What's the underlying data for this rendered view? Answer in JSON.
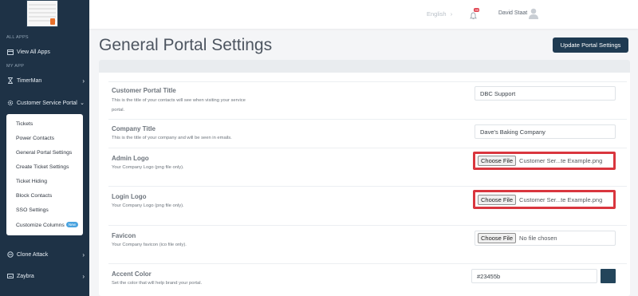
{
  "sidebar": {
    "all_apps_heading": "ALL APPS",
    "view_all_apps": "View All Apps",
    "my_app_heading": "MY APP",
    "timerman": "TimerMan",
    "customer_service_portal": "Customer Service Portal",
    "submenu": [
      {
        "label": "Tickets"
      },
      {
        "label": "Power Contacts"
      },
      {
        "label": "General Portal Settings"
      },
      {
        "label": "Create Ticket Settings"
      },
      {
        "label": "Ticket Hiding"
      },
      {
        "label": "Block Contacts"
      },
      {
        "label": "SSO Settings"
      },
      {
        "label": "Customize Columns",
        "badge": "New"
      }
    ],
    "clone_attack": "Clone Attack",
    "zaybra": "Zaybra"
  },
  "topbar": {
    "language": "English",
    "notification_count": "99",
    "user_name": "David Staat"
  },
  "page": {
    "title": "General Portal Settings",
    "update_button": "Update Portal Settings"
  },
  "settings": {
    "customer_portal_title": {
      "title": "Customer Portal Title",
      "description": "This is the title of your contacts will see when visiting your service portal.",
      "value": "DBC Support"
    },
    "company_title": {
      "title": "Company Title",
      "description": "This is the title of your company and will be seen in emails.",
      "value": "Dave's Baking Company"
    },
    "admin_logo": {
      "title": "Admin Logo",
      "description": "Your Company Logo (png file only).",
      "button": "Choose File",
      "file": "Customer Ser...te Example.png"
    },
    "login_logo": {
      "title": "Login Logo",
      "description": "Your Company Logo (png file only).",
      "button": "Choose File",
      "file": "Customer Ser...te Example.png"
    },
    "favicon": {
      "title": "Favicon",
      "description": "Your Company favicon (ico file only).",
      "button": "Choose File",
      "file": "No file chosen"
    },
    "accent_color": {
      "title": "Accent Color",
      "description": "Set the color that will help brand your portal.",
      "value": "#23455b",
      "swatch": "#23455b"
    }
  },
  "colors": {
    "sidebar_bg": "#1e3246",
    "primary_button": "#1f3b52",
    "highlight_border": "#d9363e",
    "new_badge": "#4aa3df"
  }
}
